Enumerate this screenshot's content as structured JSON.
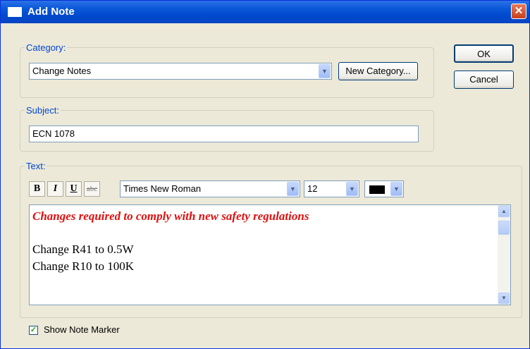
{
  "window": {
    "title": "Add Note",
    "close_symbol": "✕"
  },
  "category": {
    "label": "Category:",
    "selected": "Change Notes",
    "new_category_button": "New Category..."
  },
  "subject": {
    "label": "Subject:",
    "value": "ECN 1078"
  },
  "text_group": {
    "label": "Text:",
    "format_buttons": {
      "bold": "B",
      "italic": "I",
      "underline": "U",
      "strike": "abc"
    },
    "font": "Times New Roman",
    "size": "12",
    "color": "#000000",
    "content_lines": [
      "Changes required to comply with new safety regulations",
      "Change R41 to 0.5W",
      "Change R10 to 100K"
    ],
    "heading_color": "#e01010"
  },
  "buttons": {
    "ok": "OK",
    "cancel": "Cancel"
  },
  "show_marker": {
    "label": "Show Note Marker",
    "checked": true
  }
}
